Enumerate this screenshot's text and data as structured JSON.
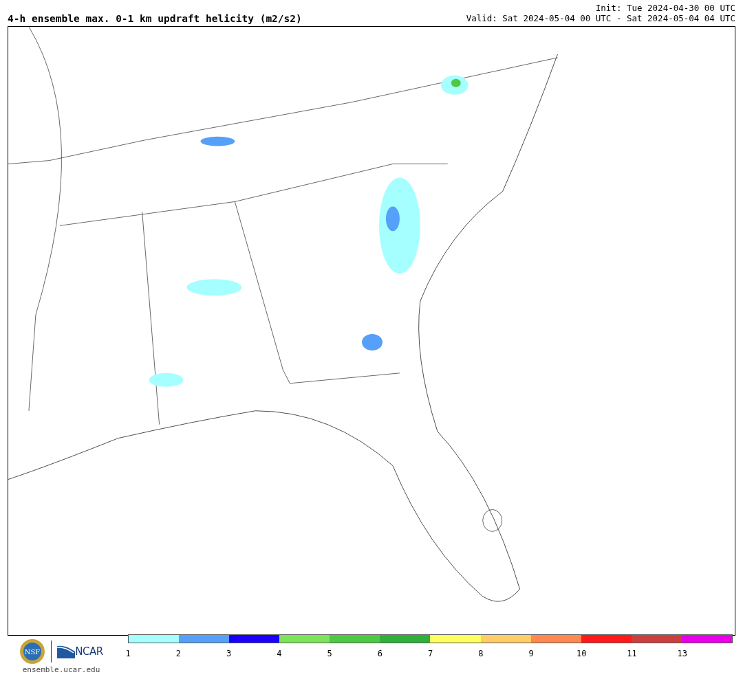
{
  "title": "4-h ensemble max. 0-1 km updraft helicity (m2/s2)",
  "init": "Init: Tue 2024-04-30 00 UTC",
  "valid": "Valid: Sat 2024-05-04 00 UTC - Sat 2024-05-04 04 UTC",
  "logos": {
    "nsf": "NSF",
    "ncar": "NCAR",
    "url": "ensemble.ucar.edu"
  },
  "colorbar": [
    {
      "label": "1",
      "color": "#a6ffff"
    },
    {
      "label": "2",
      "color": "#56a0fa"
    },
    {
      "label": "3",
      "color": "#1a00fb"
    },
    {
      "label": "4",
      "color": "#7de35a"
    },
    {
      "label": "5",
      "color": "#4dc943"
    },
    {
      "label": "6",
      "color": "#2eb03b"
    },
    {
      "label": "7",
      "color": "#ffff5f"
    },
    {
      "label": "8",
      "color": "#ffcd68"
    },
    {
      "label": "9",
      "color": "#ff884f"
    },
    {
      "label": "10",
      "color": "#ff1a1a"
    },
    {
      "label": "11",
      "color": "#cc3f3f"
    },
    {
      "label": "13",
      "color": "#e800e8"
    }
  ]
}
